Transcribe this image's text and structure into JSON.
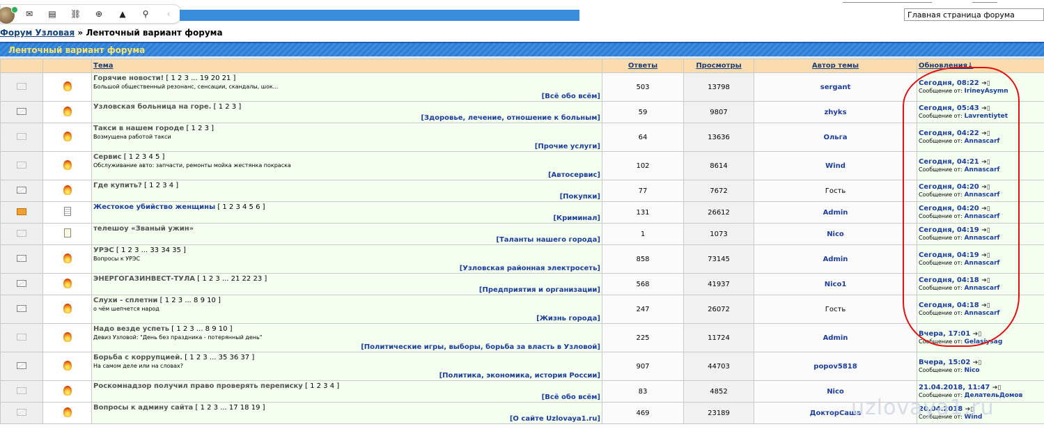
{
  "topbar": {
    "icons": [
      "avatar",
      "envelope-icon",
      "document-icon",
      "link-icon",
      "plus-circle-icon",
      "bell-icon",
      "search-icon",
      "chevron-left-icon"
    ],
    "forum_select_value": "Главная страница форума"
  },
  "breadcrumb": {
    "forum": "Форум Узловая",
    "separator": "»",
    "current": "Ленточный вариант форума"
  },
  "title_bar": "Ленточный вариант форума",
  "columns": {
    "topic": "Тема",
    "replies": "Ответы",
    "views": "Просмотры",
    "author": "Автор темы",
    "updates": "Обновления↓"
  },
  "rows": [
    {
      "title": "Горячие новости!",
      "pages": "[ 1 2 3 ... 19 20 21 ]",
      "desc": "Большой общественный резонанс, сенсации, скандалы, шок...",
      "category": "[Всё обо всём]",
      "replies": "503",
      "views": "13798",
      "author": "sergant",
      "time": "Сегодня, 08:22",
      "by_label": "Сообщение от:",
      "by": "IrineyAsymn",
      "icon1": "envelope-dim",
      "icon2": "hot-topic-icon"
    },
    {
      "title": "Узловская больница на горе.",
      "pages": "[ 1 2 3 ]",
      "desc": "",
      "category": "[Здоровье, лечение, отношение к больным]",
      "replies": "59",
      "views": "9807",
      "author": "zhyks",
      "time": "Сегодня, 05:43",
      "by_label": "Сообщение от:",
      "by": "Lavrentiytet",
      "icon1": "envelope",
      "icon2": "hot-topic-icon"
    },
    {
      "title": "Такси в нашем городе",
      "pages": "[ 1 2 3 ]",
      "desc": "Возмущена работой такси",
      "category": "[Прочие услуги]",
      "replies": "64",
      "views": "13636",
      "author": "Ольга",
      "time": "Сегодня, 04:22",
      "by_label": "Сообщение от:",
      "by": "Annascarf",
      "icon1": "envelope-dim",
      "icon2": "hot-topic-icon"
    },
    {
      "title": "Сервис",
      "pages": "[ 1 2 3 4 5 ]",
      "desc": "Обслуживание авто: запчасти, ремонты мойка жестянка покраска",
      "category": "[Автосервис]",
      "replies": "102",
      "views": "8614",
      "author": "Wind",
      "time": "Сегодня, 04:21",
      "by_label": "Сообщение от:",
      "by": "Annascarf",
      "icon1": "envelope-dim",
      "icon2": "hot-topic-icon"
    },
    {
      "title": "Где купить?",
      "pages": "[ 1 2 3 4 ]",
      "desc": "",
      "category": "[Покупки]",
      "replies": "77",
      "views": "7672",
      "author": "Гость",
      "time": "Сегодня, 04:20",
      "by_label": "Сообщение от:",
      "by": "Annascarf",
      "icon1": "envelope",
      "icon2": "hot-topic-icon"
    },
    {
      "title": "Жестокое убийство женщины",
      "pages": "[ 1 2 3 4 5 6 ]",
      "desc": "",
      "category": "[Криминал]",
      "replies": "131",
      "views": "26612",
      "author": "Admin",
      "time": "Сегодня, 04:20",
      "by_label": "Сообщение от:",
      "by": "Annascarf",
      "icon1": "rss-icon",
      "icon2": "document-icon"
    },
    {
      "title": "телешоу «Званый ужин»",
      "pages": "",
      "desc": "",
      "category": "[Таланты нашего города]",
      "replies": "1",
      "views": "1073",
      "author": "Nico",
      "time": "Сегодня, 04:19",
      "by_label": "Сообщение от:",
      "by": "Annascarf",
      "icon1": "envelope-dim",
      "icon2": "note-icon"
    },
    {
      "title": "УРЭС",
      "pages": "[ 1 2 3 ... 33 34 35 ]",
      "desc": "Вопросы к УРЭС",
      "category": "[Узловская районная электросеть]",
      "replies": "858",
      "views": "73145",
      "author": "Admin",
      "time": "Сегодня, 04:19",
      "by_label": "Сообщение от:",
      "by": "Annascarf",
      "icon1": "envelope",
      "icon2": "hot-topic-icon"
    },
    {
      "title": "ЭНЕРГОГАЗИНВЕСТ-ТУЛА",
      "pages": "[ 1 2 3 ... 21 22 23 ]",
      "desc": "",
      "category": "[Предприятия и организации]",
      "replies": "568",
      "views": "41937",
      "author": "Nico1",
      "time": "Сегодня, 04:18",
      "by_label": "Сообщение от:",
      "by": "Annascarf",
      "icon1": "envelope",
      "icon2": "hot-topic-icon"
    },
    {
      "title": "Слухи - сплетни",
      "pages": "[ 1 2 3 ... 8 9 10 ]",
      "desc": "о чём шепчется народ",
      "category": "[Жизнь города]",
      "replies": "247",
      "views": "26072",
      "author": "Гость",
      "time": "Сегодня, 04:18",
      "by_label": "Сообщение от:",
      "by": "Annascarf",
      "icon1": "envelope",
      "icon2": "hot-topic-icon"
    },
    {
      "title": "Надо везде успеть",
      "pages": "[ 1 2 3 ... 8 9 10 ]",
      "desc": "Девиз Узловой: \"День без праздника - потерянный день\"",
      "category": "[Политические игры, выборы, борьба за власть в Узловой]",
      "replies": "225",
      "views": "11724",
      "author": "Admin",
      "time": "Вчера, 17:01",
      "by_label": "Сообщение от:",
      "by": "Gelasiysag",
      "icon1": "envelope-dim",
      "icon2": "hot-topic-icon"
    },
    {
      "title": "Борьба с коррупцией.",
      "pages": "[ 1 2 3 ... 35 36 37 ]",
      "desc": "На самом деле или на словах?",
      "category": "[Политика, экономика, история России]",
      "replies": "907",
      "views": "44703",
      "author": "popov5818",
      "time": "Вчера, 15:02",
      "by_label": "Сообщение от:",
      "by": "Nico",
      "icon1": "envelope",
      "icon2": "hot-topic-icon"
    },
    {
      "title": "Роскомнадзор получил право проверять переписку",
      "pages": "[ 1 2 3 4 ]",
      "desc": "",
      "category": "[Всё обо всём]",
      "replies": "83",
      "views": "4852",
      "author": "Nico",
      "time": "21.04.2018, 11:47",
      "by_label": "Сообщение от:",
      "by": "ДелательДомов",
      "icon1": "envelope-dim",
      "icon2": "hot-topic-icon"
    },
    {
      "title": "Вопросы к админу сайта",
      "pages": "[ 1 2 3 ... 17 18 19 ]",
      "desc": "",
      "category": "[О сайте Uzlovaya1.ru]",
      "replies": "469",
      "views": "23189",
      "author": "ДокторСаша",
      "time": "20.04.2018",
      "by_label": "Сообщение от:",
      "by": "Wind",
      "icon1": "envelope-dim",
      "icon2": "hot-topic-icon"
    }
  ],
  "colors": {
    "accent_blue": "#3a8ddb",
    "header_bg": "#fbdcae",
    "row_green": "#f4fff0",
    "link_blue": "#1c3d9c",
    "annotation_red": "#e01010"
  },
  "watermark": "uzlovaya1.ru"
}
